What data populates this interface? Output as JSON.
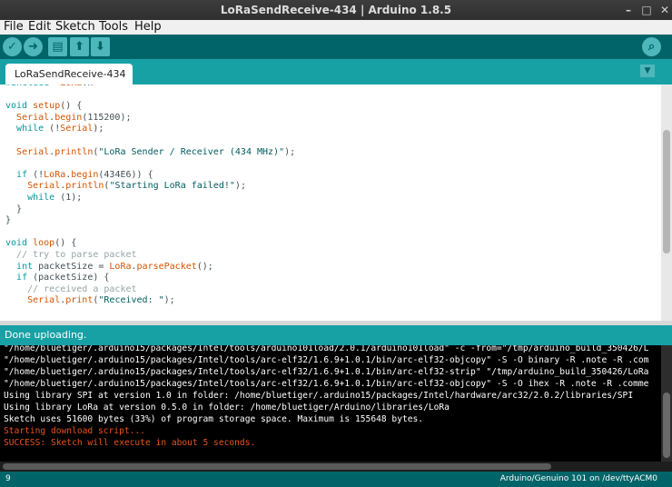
{
  "window": {
    "title": "LoRaSendReceive-434 | Arduino 1.8.5",
    "minimize_glyph": "–",
    "maximize_glyph": "□",
    "close_glyph": "✕"
  },
  "menu": [
    "File",
    "Edit",
    "Sketch",
    "Tools",
    "Help"
  ],
  "toolbar": {
    "verify_glyph": "✓",
    "upload_glyph": "➜",
    "new_glyph": "▤",
    "open_glyph": "⬆",
    "save_glyph": "⬇",
    "serial_glyph": "⌕"
  },
  "tab": {
    "label": "LoRaSendReceive-434",
    "menu_glyph": "▼"
  },
  "status": {
    "message": "Done uploading."
  },
  "footer": {
    "line_number": "9",
    "board": "Arduino/Genuino 101 on /dev/ttyACM0"
  },
  "icons": {
    "verify": "checkmark-icon",
    "upload": "arrow-right-icon",
    "new": "new-file-icon",
    "open": "open-arrow-up-icon",
    "save": "save-arrow-down-icon",
    "serial": "magnifier-icon"
  },
  "colors": {
    "toolbar": "#006468",
    "tabrow": "#17a1a5",
    "keyword": "#00979c",
    "object": "#d35400",
    "error_text": "#e8541e"
  }
}
